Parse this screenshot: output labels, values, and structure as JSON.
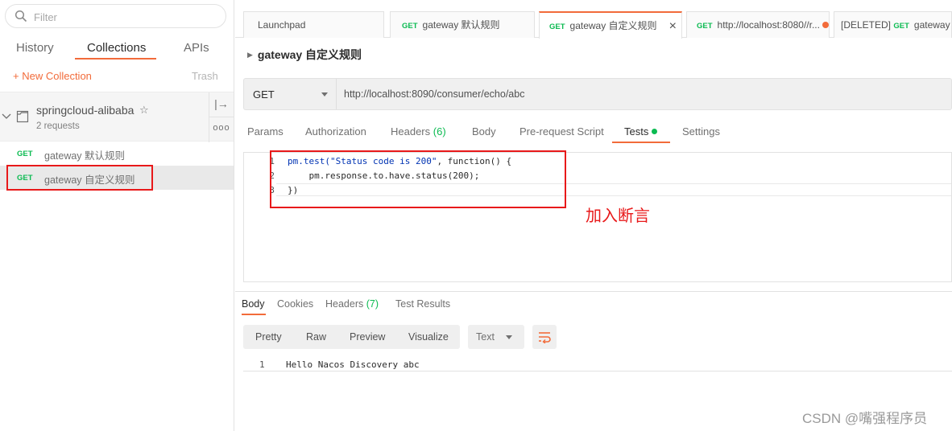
{
  "sidebar": {
    "filter_placeholder": "Filter",
    "tabs": [
      "History",
      "Collections",
      "APIs"
    ],
    "new_collection": "+ New Collection",
    "trash": "Trash",
    "collection": {
      "name": "springcloud-alibaba",
      "count": "2 requests",
      "star": "☆",
      "share_icon": "|→",
      "more_icon": "ooo"
    },
    "requests": [
      {
        "method": "GET",
        "name": "gateway 默认规则"
      },
      {
        "method": "GET",
        "name": "gateway 自定义规则"
      }
    ]
  },
  "tabs": [
    {
      "method": "",
      "label": "Launchpad"
    },
    {
      "method": "GET",
      "label": "gateway 默认规则"
    },
    {
      "method": "GET",
      "label": "gateway 自定义规则",
      "close": "×"
    },
    {
      "method": "GET",
      "label": "http://localhost:8080//r..."
    },
    {
      "prefix": "[DELETED]",
      "method": "GET",
      "label": "gateway 自..."
    }
  ],
  "breadcrumb": "gateway 自定义规则",
  "request": {
    "method": "GET",
    "url": "http://localhost:8090/consumer/echo/abc"
  },
  "request_tabs": {
    "params": "Params",
    "authorization": "Authorization",
    "headers": "Headers",
    "headers_count": "(6)",
    "body": "Body",
    "prerequest": "Pre-request Script",
    "tests": "Tests",
    "settings": "Settings"
  },
  "editor": {
    "line_numbers": [
      "1",
      "2",
      "3"
    ],
    "line1_fn": "pm.test(",
    "line1_str": "\"Status code is 200\"",
    "line1_rest": ", function() {",
    "line2": "    pm.response.to.have.status(200);",
    "line3": "})"
  },
  "annotation": "加入断言",
  "response_tabs": {
    "body": "Body",
    "cookies": "Cookies",
    "headers": "Headers",
    "headers_count": "(7)",
    "test_results": "Test Results"
  },
  "format": {
    "pretty": "Pretty",
    "raw": "Raw",
    "preview": "Preview",
    "visualize": "Visualize",
    "type": "Text"
  },
  "response": {
    "line_number": "1",
    "text": "Hello Nacos Discovery abc"
  },
  "watermark": "CSDN @嘴强程序员",
  "colors": {
    "accent": "#f26b3a",
    "get": "#0cbb52",
    "annotation": "#e8191a"
  }
}
